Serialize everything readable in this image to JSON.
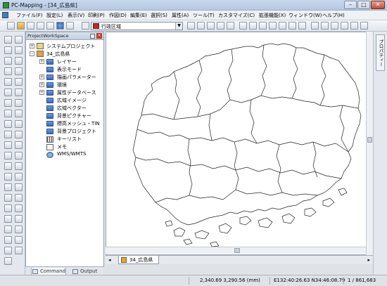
{
  "window": {
    "title": "PC-Mapping - [34_広島県]"
  },
  "menu": [
    "ファイル(F)",
    "設定(L)",
    "表示(V)",
    "印刷(P)",
    "作図(D)",
    "編集(E)",
    "選択(S)",
    "属性(A)",
    "ツール(T)",
    "カスタマイズ(C)",
    "拡張機能(X)",
    "ウィンドウ(W)",
    "ヘルプ(H)"
  ],
  "toolbar": {
    "layer_combo_value": "行政区域"
  },
  "panel": {
    "title": "ProjectWorkSpace",
    "items": [
      {
        "label": "システムプロジェクト",
        "level": 0,
        "expander": "+",
        "icon": "project-icon"
      },
      {
        "label": "34_広島県",
        "level": 0,
        "expander": "-",
        "icon": "project-icon"
      },
      {
        "label": "レイヤー",
        "level": 1,
        "expander": "+",
        "icon": "folder-icon"
      },
      {
        "label": "表示モード",
        "level": 1,
        "expander": "",
        "icon": "folder-icon"
      },
      {
        "label": "描画パラメーター",
        "level": 1,
        "expander": "+",
        "icon": "folder-icon"
      },
      {
        "label": "環境",
        "level": 1,
        "expander": "+",
        "icon": "folder-icon"
      },
      {
        "label": "属性データベース",
        "level": 1,
        "expander": "+",
        "icon": "folder-icon"
      },
      {
        "label": "広域イメージ",
        "level": 1,
        "expander": "",
        "icon": "folder-icon"
      },
      {
        "label": "広域ベクター",
        "level": 1,
        "expander": "",
        "icon": "folder-icon"
      },
      {
        "label": "背景ピクチャー",
        "level": 1,
        "expander": "",
        "icon": "folder-icon"
      },
      {
        "label": "標高メッシュ・TIN",
        "level": 1,
        "expander": "",
        "icon": "folder-icon"
      },
      {
        "label": "背景プロジェクト",
        "level": 1,
        "expander": "",
        "icon": "folder-icon"
      },
      {
        "label": "キーリスト",
        "level": 1,
        "expander": "",
        "icon": "list-icon"
      },
      {
        "label": "メモ",
        "level": 1,
        "expander": "",
        "icon": "memo-icon"
      },
      {
        "label": "WMS/WMTS",
        "level": 1,
        "expander": "",
        "icon": "globe-icon"
      }
    ],
    "tabs": [
      "Command",
      "Output"
    ]
  },
  "document": {
    "tab_label": "34_広島県"
  },
  "right_dock": {
    "tab_label": "プロパティー"
  },
  "status": {
    "coords": "2,340.69 3,290.56 (mm)",
    "latlon": "E132:40:26.63 N34:46:08.79",
    "scale": "1 / 861,683"
  }
}
